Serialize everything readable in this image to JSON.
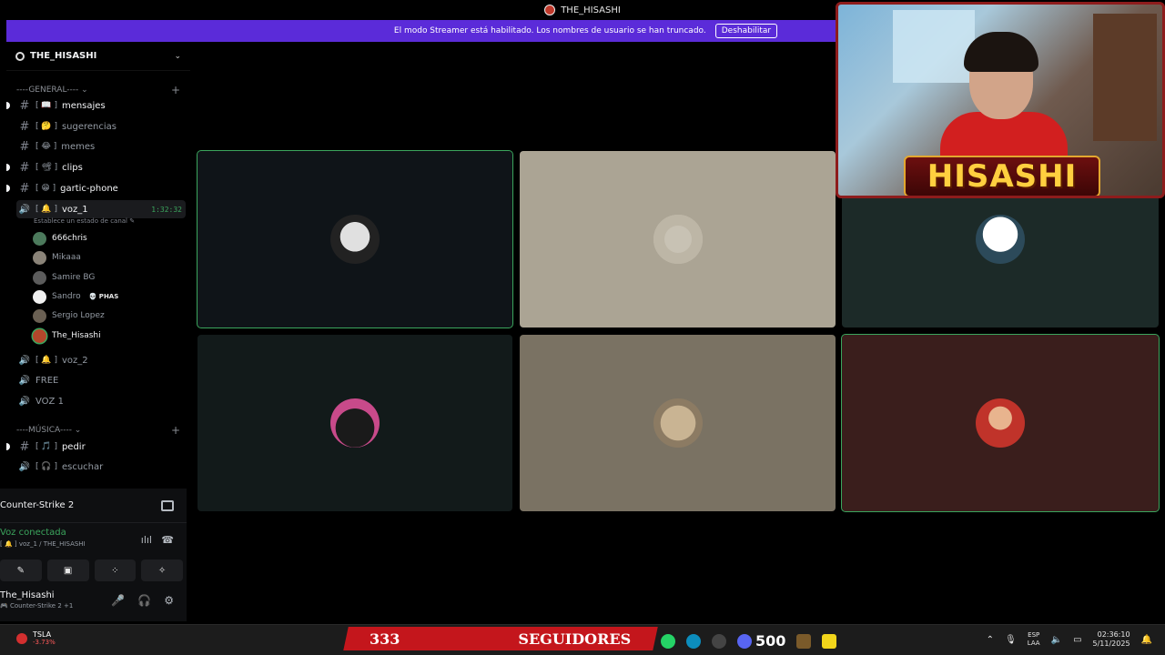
{
  "window": {
    "title": "THE_HISASHI"
  },
  "banner": {
    "message": "El modo Streamer está habilitado. Los nombres de usuario se han truncado.",
    "button": "Deshabilitar"
  },
  "server": {
    "name": "THE_HISASHI"
  },
  "categories": {
    "general": "----GENERAL---- ⌄",
    "musica": "----MÚSICA---- ⌄"
  },
  "channels": {
    "mensajes": {
      "label": "mensajes",
      "bracket": "[ 📖 ]"
    },
    "sugerencias": {
      "label": "sugerencias",
      "bracket": "[ 🤔 ]"
    },
    "memes": {
      "label": "memes",
      "bracket": "[ 😂 ]"
    },
    "clips": {
      "label": "clips",
      "bracket": "[ 📽 ]"
    },
    "gartic": {
      "label": "gartic-phone",
      "bracket": "[ 😁 ]"
    },
    "voz1": {
      "label": "voz_1",
      "bracket": "[ 🔔 ]",
      "timer": "1:32:32",
      "status": "Establece un estado de canal ✎"
    },
    "voz2": {
      "label": "voz_2",
      "bracket": "[ 🔔 ]"
    },
    "free": {
      "label": "FREE"
    },
    "voz1b": {
      "label": "VOZ 1"
    },
    "pedir": {
      "label": "pedir",
      "bracket": "[ 🎵 ]"
    },
    "escuchar": {
      "label": "escuchar",
      "bracket": "[ 🎧 ]"
    }
  },
  "members": [
    {
      "name": "666chris",
      "color": "#4c7a5c"
    },
    {
      "name": "Mikaaa",
      "color": "#8a8378"
    },
    {
      "name": "Samire BG",
      "color": "#5c5c5c"
    },
    {
      "name": "Sandro",
      "color": "#f0f0f0",
      "tag": "💀 PHAS"
    },
    {
      "name": "Sergio Lopez",
      "color": "#6a6053"
    },
    {
      "name": "The_Hisashi",
      "color": "#b3472b"
    }
  ],
  "panel": {
    "game": "Counter-Strike 2",
    "voice_status": "Voz conectada",
    "voice_location": "[ 🔔 ] voz_1 / THE_HISASHI",
    "user_name": "The_Hisashi",
    "user_sub": "🎮 Counter-Strike 2 +1"
  },
  "tiles": [
    {
      "bg": "#0f1418",
      "avatar": "#d8d8d8",
      "speaking": true
    },
    {
      "bg": "#aba494",
      "avatar": "#c8c2b4",
      "speaking": false
    },
    {
      "bg": "#1c2a28",
      "avatar": "#e6eef0",
      "speaking": false
    },
    {
      "bg": "#121a1a",
      "avatar": "#2a2a2a",
      "speaking": false
    },
    {
      "bg": "#7a7263",
      "avatar": "#b8a58a",
      "speaking": false
    },
    {
      "bg": "#3a1e1c",
      "avatar": "#c0332a",
      "speaking": true
    }
  ],
  "webcam": {
    "overlay_name": "HISASHI"
  },
  "taskbar": {
    "stock_name": "TSLA",
    "stock_change": "-3.73%",
    "followers_count": "333",
    "followers_label": "SEGUIDORES",
    "app_count": "500",
    "lang_top": "ESP",
    "lang_bottom": "LAA",
    "time": "02:36:10",
    "date": "5/11/2025"
  },
  "colors": {
    "accent": "#5b2bd9",
    "voice_green": "#3ba55d",
    "overlay_red": "#c4161c"
  }
}
